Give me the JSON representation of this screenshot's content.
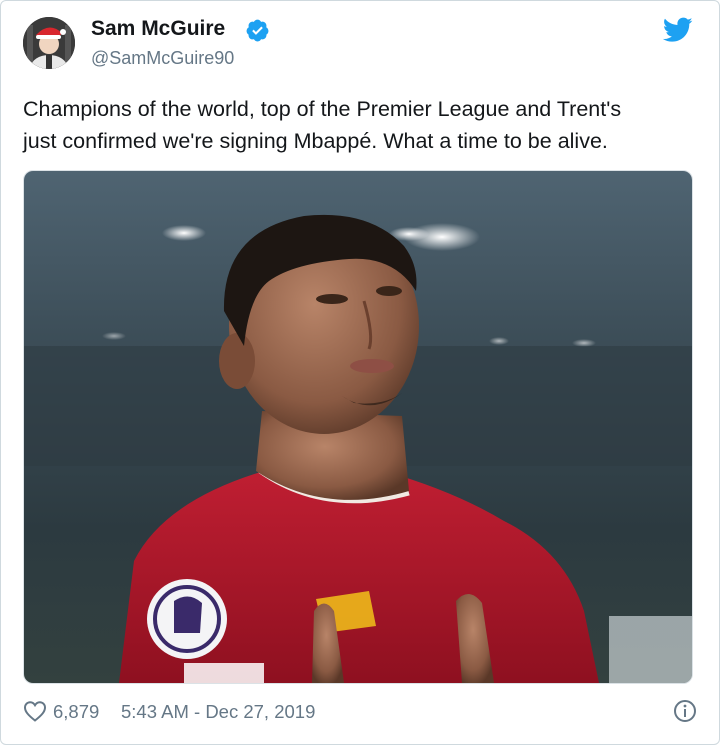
{
  "tweet": {
    "author_name": "Sam McGuire",
    "author_handle": "@SamMcGuire90",
    "verified_icon": "verified-badge-icon",
    "brand_icon": "twitter-bird-icon",
    "text_line1": "Champions of the world, top of the Premier League and Trent's",
    "text_line2": "just confirmed we're signing Mbappé. What a time to be alive.",
    "likes": "6,879",
    "timestamp": "5:43 AM - Dec 27, 2019",
    "info_icon": "info-icon",
    "like_icon": "heart-icon"
  },
  "colors": {
    "twitter_blue": "#1da1f2",
    "text_primary": "#14171a",
    "text_secondary": "#657786",
    "kit_red": "#b5182a"
  }
}
